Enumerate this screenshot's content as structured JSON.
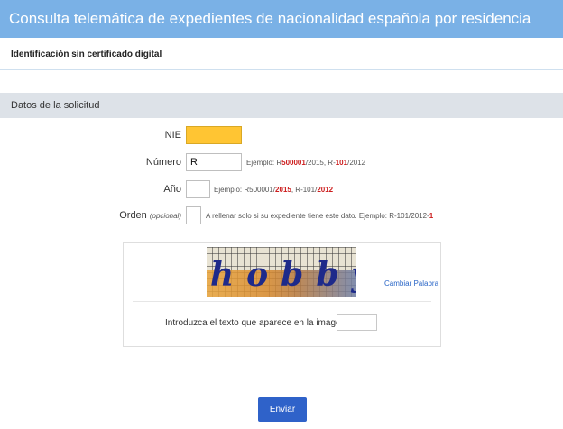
{
  "colors": {
    "header_bg": "#7ab1e6",
    "section_bg": "#dde2e8",
    "focus_bg": "#ffc533",
    "button_bg": "#2f62c9",
    "highlight": "#cc1d1d"
  },
  "header": {
    "title": "Consulta telemática de expedientes de nacionalidad española por residencia"
  },
  "subheader": {
    "title": "Identificación sin certificado digital"
  },
  "section": {
    "title": "Datos de la solicitud"
  },
  "form": {
    "nie": {
      "label": "NIE",
      "value": ""
    },
    "numero": {
      "label": "Número",
      "value": "R",
      "hint": {
        "prefix": "Ejemplo: R",
        "b1": "500001",
        "mid": "/2015, R-",
        "b2": "101",
        "suffix": "/2012"
      }
    },
    "anio": {
      "label": "Año",
      "value": "",
      "hint": {
        "prefix": "Ejemplo: R500001/",
        "b1": "2015",
        "mid": ", R-101/",
        "b2": "2012"
      }
    },
    "orden": {
      "label": "Orden",
      "optional": "(opcional)",
      "value": "",
      "hint": {
        "prefix": "A rellenar solo si su expediente tiene este dato. Ejemplo: R-101/2012-",
        "b1": "1"
      }
    }
  },
  "captcha": {
    "word": "hobby",
    "change_label": "Cambiar Palabra",
    "input_label": "Introduzca el texto que aparece en la imagen",
    "input_value": ""
  },
  "submit": {
    "label": "Enviar"
  }
}
